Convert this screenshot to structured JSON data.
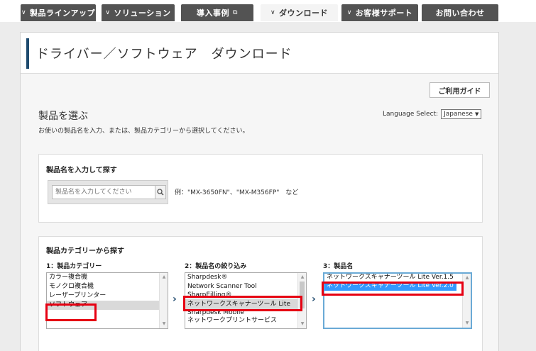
{
  "nav": {
    "tabs": [
      {
        "label": "製品ラインアップ",
        "chevron": "∨",
        "ext": ""
      },
      {
        "label": "ソリューション",
        "chevron": "∨",
        "ext": ""
      },
      {
        "label": "導入事例",
        "chevron": "",
        "ext": "⧉"
      },
      {
        "label": "ダウンロード",
        "chevron": "∨",
        "ext": ""
      },
      {
        "label": "お客様サポート",
        "chevron": "∨",
        "ext": ""
      },
      {
        "label": "お問い合わせ",
        "chevron": "",
        "ext": ""
      }
    ],
    "active_index": 3
  },
  "page": {
    "title": "ドライバー／ソフトウェア　ダウンロード",
    "guide_button": "ご利用ガイド"
  },
  "select_section": {
    "title": "製品を選ぶ",
    "description": "お使いの製品名を入力、または、製品カテゴリーから選択してください。",
    "language_label": "Language Select:",
    "language_value": "Japanese"
  },
  "search_box": {
    "heading": "製品名を入力して探す",
    "placeholder": "製品名を入力してください",
    "example": "例：\"MX-3650FN\"、\"MX-M356FP\"　など"
  },
  "category_box": {
    "heading": "製品カテゴリーから探す",
    "columns": [
      {
        "label": "1：製品カテゴリー",
        "items": [
          "カラー複合機",
          "モノクロ複合機",
          "レーザープリンター",
          "ソフトウェア",
          "",
          ""
        ],
        "selected": 3
      },
      {
        "label": "2：製品名の絞り込み",
        "items": [
          "Sharpdesk®",
          "Network Scanner Tool",
          "SharpEilling®",
          "ネットワークスキャナーツール Lite",
          "Sharpdesk Mobile",
          "ネットワークプリントサービス"
        ],
        "selected": 3
      },
      {
        "label": "3：製品名",
        "items": [
          "ネットワークスキャナーツール Lite Ver.1.5",
          "ネットワークスキャナーツール Lite Ver.2.0"
        ],
        "selected": 1
      }
    ]
  },
  "colors": {
    "nav_bg": "#535353",
    "accent": "#1e4a6e",
    "highlight": "#e60012",
    "selection_blue": "#3399ff"
  }
}
